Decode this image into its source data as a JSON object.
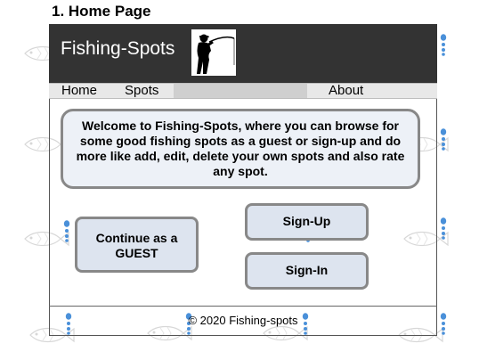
{
  "section": {
    "title": "1. Home Page"
  },
  "header": {
    "brand": "Fishing-Spots",
    "logo_icon": "fisherman-icon",
    "background": "#333333"
  },
  "nav": {
    "items": [
      {
        "label": "Home"
      },
      {
        "label": "Spots"
      },
      {
        "label": "About"
      }
    ]
  },
  "welcome": {
    "text": "Welcome to Fishing-Spots, where you can browse for some good fishing spots as a guest or sign-up and do more like add, edit, delete your own spots and also rate any spot."
  },
  "buttons": {
    "guest": "Continue as a GUEST",
    "signup": "Sign-Up",
    "signin": "Sign-In"
  },
  "footer": {
    "text": "© 2020 Fishing-spots"
  },
  "decor": {
    "watermark_icon": "fish-icon",
    "bubble_icon": "bubbles-icon",
    "accent": "#4a90d9"
  }
}
